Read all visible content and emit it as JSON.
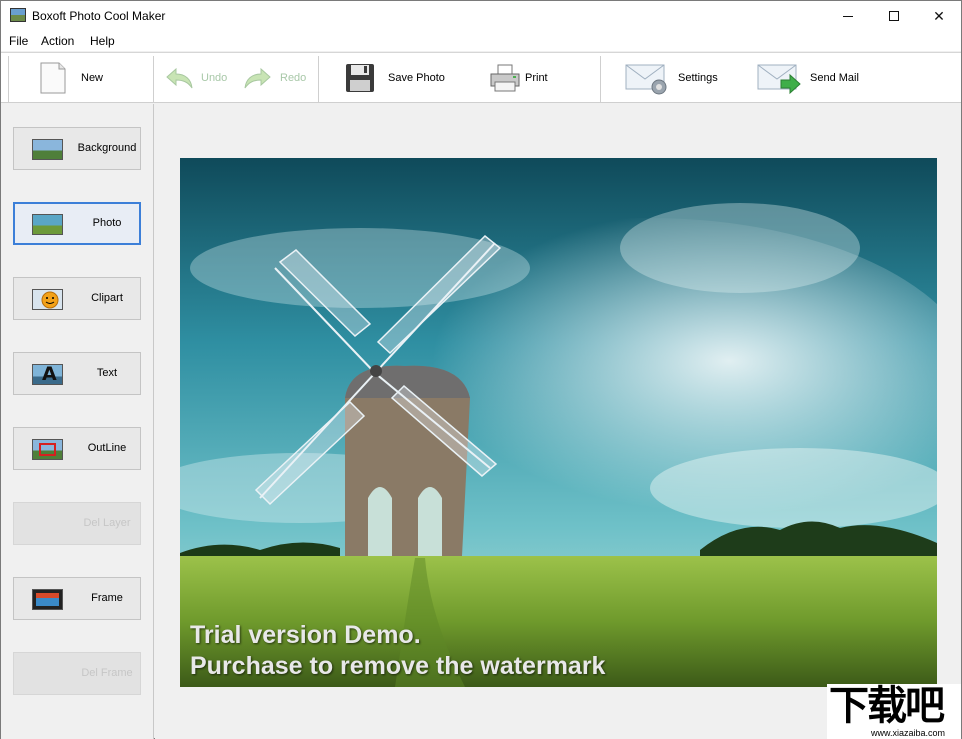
{
  "window": {
    "title": "Boxoft Photo Cool Maker",
    "controls": {
      "minimize": "minimize",
      "maximize": "maximize",
      "close": "✕"
    }
  },
  "menu": [
    "File",
    "Action",
    "Help"
  ],
  "toolbar": {
    "new": "New",
    "undo": "Undo",
    "redo": "Redo",
    "save_photo": "Save Photo",
    "print": "Print",
    "settings": "Settings",
    "send_mail": "Send Mail"
  },
  "sidebar": [
    {
      "label": "Background",
      "icon": "landscape-icon",
      "state": "normal"
    },
    {
      "label": "Photo",
      "icon": "photo-icon",
      "state": "active"
    },
    {
      "label": "Clipart",
      "icon": "clipart-smiley-icon",
      "state": "normal"
    },
    {
      "label": "Text",
      "icon": "text-a-icon",
      "state": "normal"
    },
    {
      "label": "OutLine",
      "icon": "outline-icon",
      "state": "normal"
    },
    {
      "label": "Del Layer",
      "icon": "delete-layer-icon",
      "state": "disabled"
    },
    {
      "label": "Frame",
      "icon": "frame-icon",
      "state": "normal"
    },
    {
      "label": "Del Frame",
      "icon": "delete-frame-icon",
      "state": "disabled"
    }
  ],
  "canvas": {
    "watermark_line1": "Trial version Demo.",
    "watermark_line2": "Purchase to remove the watermark"
  },
  "site_logo": {
    "main": "下载吧",
    "url": "www.xiazaiba.com"
  },
  "colors": {
    "active_border": "#3c7fd8",
    "sky": "#3aa6b8",
    "grass": "#7aa832"
  }
}
